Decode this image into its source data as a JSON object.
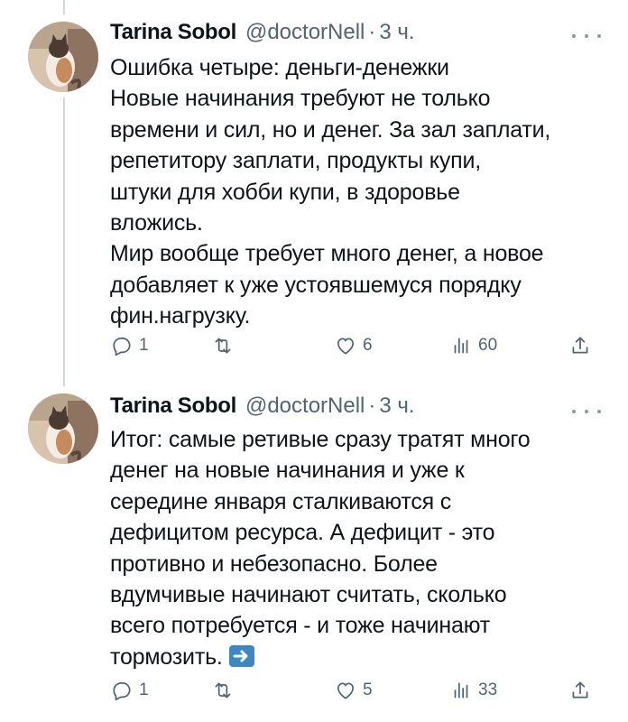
{
  "tweets": [
    {
      "author": "Tarina Sobol",
      "handle": "@doctorNell",
      "separator": "·",
      "time": "3 ч.",
      "text": "Ошибка четыре: деньги-денежки\nНовые начинания требуют не только\nвремени и сил, но и денег. За зал заплати,\nрепетитору заплати, продукты купи,\nштуки для хобби купи, в здоровье\nвложись.\nМир вообще требует много денег, а новое\nдобавляет к уже устоявшемуся порядку\nфин.нагрузку.",
      "replies": "1",
      "retweets": "",
      "likes": "6",
      "views": "60"
    },
    {
      "author": "Tarina Sobol",
      "handle": "@doctorNell",
      "separator": "·",
      "time": "3 ч.",
      "text": "Итог: самые ретивые сразу тратят много\nденег на новые начинания и уже к\nсередине января сталкиваются с\nдефицитом ресурса. А дефицит - это\nпротивно и небезопасно. Более\nвдумчивые начинают считать,  сколько\nвсего потребуется - и тоже начинают\nтормозить.",
      "emoji": "right-arrow-emoji",
      "replies": "1",
      "retweets": "",
      "likes": "5",
      "views": "33"
    }
  ],
  "icons": {
    "more": "more-horizontal-icon",
    "reply": "reply-icon",
    "retweet": "retweet-icon",
    "like": "heart-icon",
    "views": "views-chart-icon",
    "share": "share-icon"
  },
  "colors": {
    "text": "#0f1419",
    "secondary": "#536471",
    "thread_line": "#cfd9de",
    "emoji_blue": "#3b88c3"
  }
}
